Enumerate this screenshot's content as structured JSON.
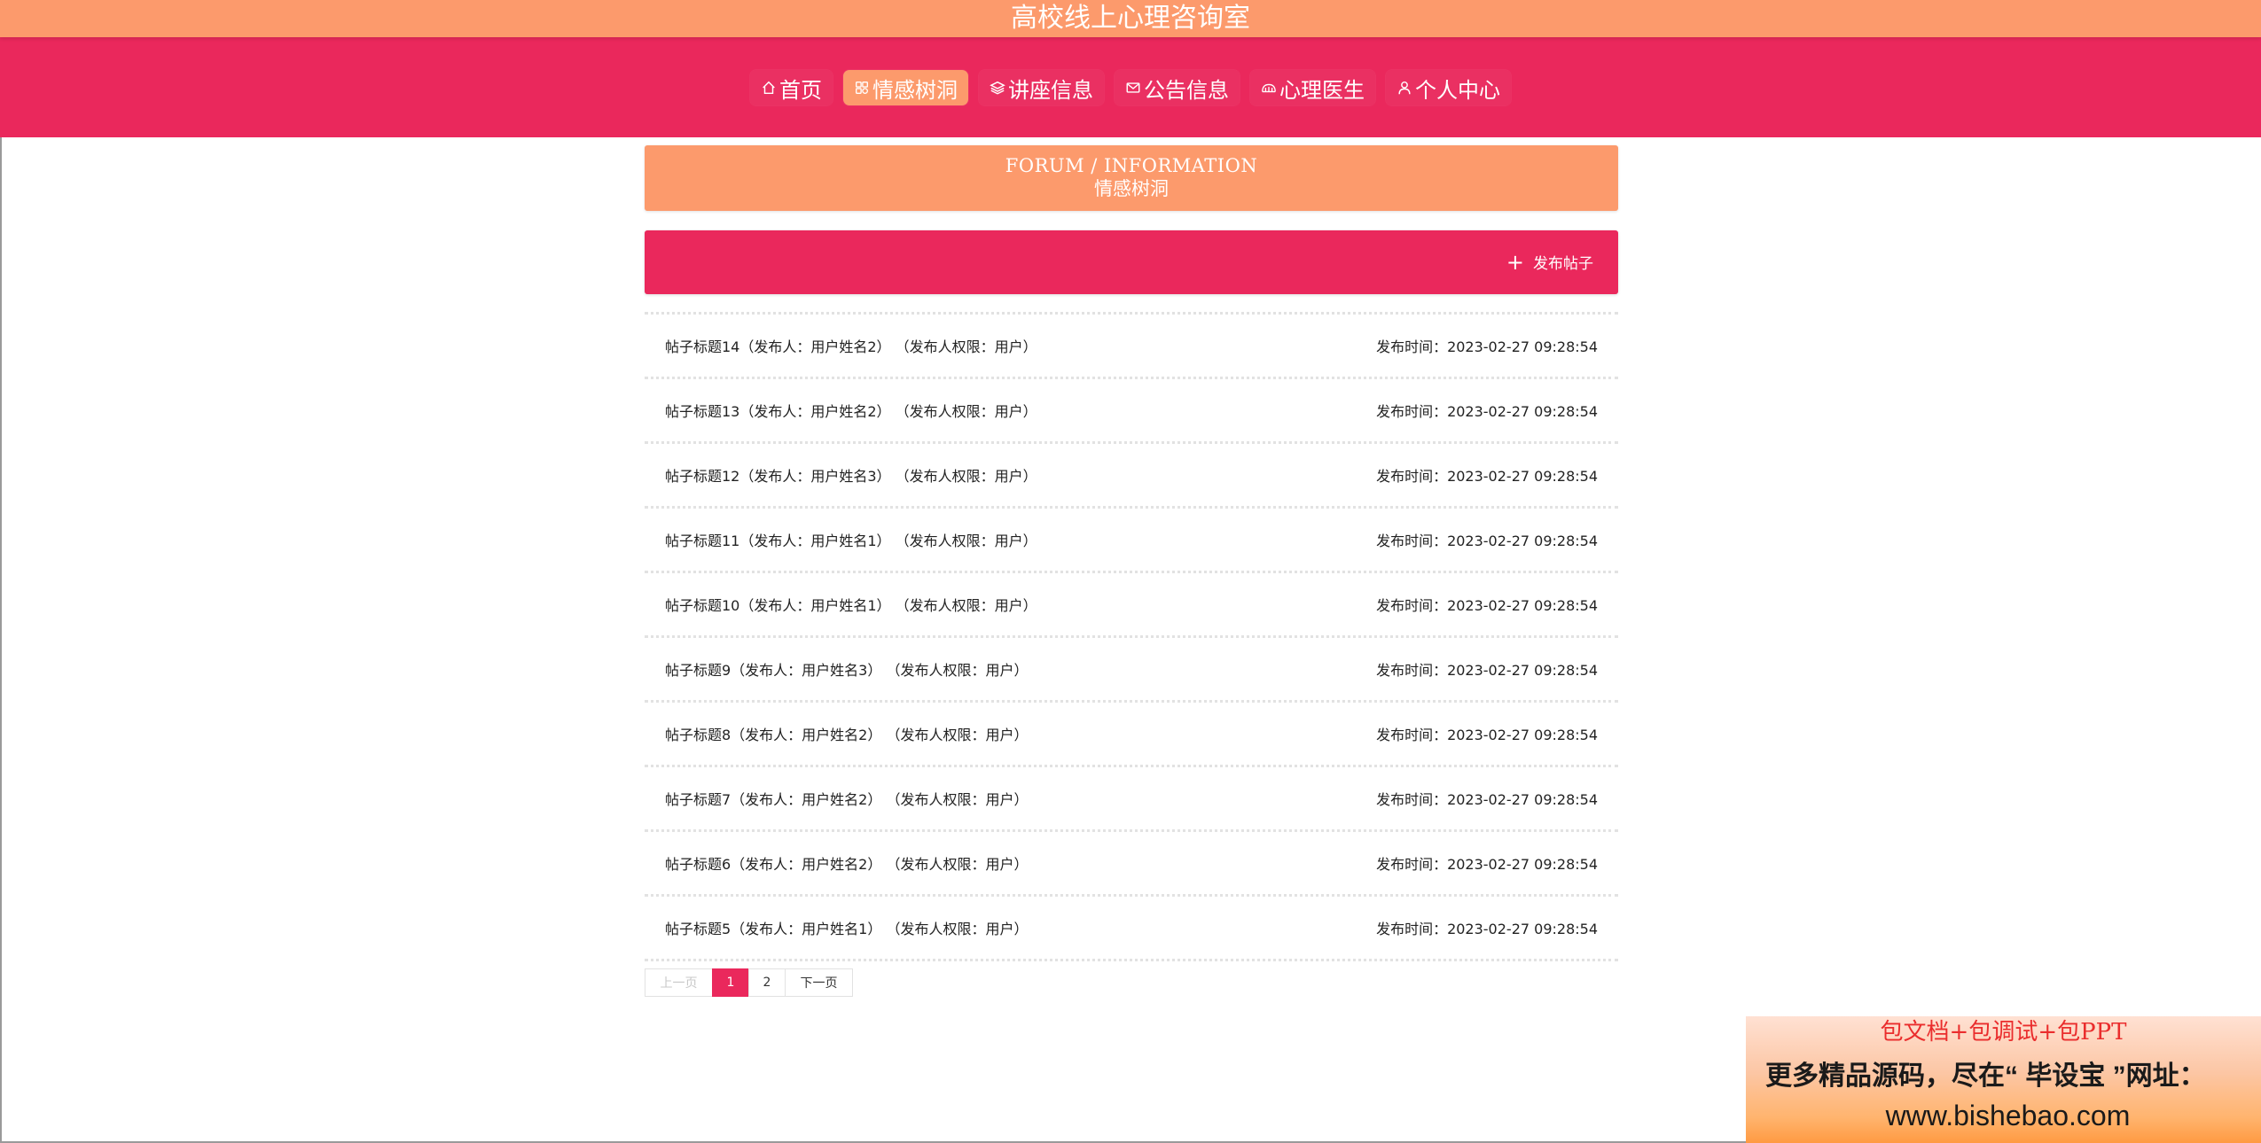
{
  "header": {
    "site_title": "高校线上心理咨询室"
  },
  "nav": {
    "items": [
      {
        "label": "首页",
        "icon": "home-icon",
        "active": false
      },
      {
        "label": "情感树洞",
        "icon": "tree-hole-icon",
        "active": true
      },
      {
        "label": "讲座信息",
        "icon": "layers-icon",
        "active": false
      },
      {
        "label": "公告信息",
        "icon": "mail-icon",
        "active": false
      },
      {
        "label": "心理医生",
        "icon": "doctor-icon",
        "active": false
      },
      {
        "label": "个人中心",
        "icon": "user-icon",
        "active": false
      }
    ]
  },
  "section": {
    "title_en": "FORUM / INFORMATION",
    "title_cn": "情感树洞"
  },
  "toolbar": {
    "publish_label": "发布帖子",
    "publish_icon": "plus-icon"
  },
  "posts": [
    {
      "title": "帖子标题14（发布人：用户姓名2） （发布人权限：用户）",
      "time": "发布时间：2023-02-27 09:28:54"
    },
    {
      "title": "帖子标题13（发布人：用户姓名2） （发布人权限：用户）",
      "time": "发布时间：2023-02-27 09:28:54"
    },
    {
      "title": "帖子标题12（发布人：用户姓名3） （发布人权限：用户）",
      "time": "发布时间：2023-02-27 09:28:54"
    },
    {
      "title": "帖子标题11（发布人：用户姓名1） （发布人权限：用户）",
      "time": "发布时间：2023-02-27 09:28:54"
    },
    {
      "title": "帖子标题10（发布人：用户姓名1） （发布人权限：用户）",
      "time": "发布时间：2023-02-27 09:28:54"
    },
    {
      "title": "帖子标题9（发布人：用户姓名3） （发布人权限：用户）",
      "time": "发布时间：2023-02-27 09:28:54"
    },
    {
      "title": "帖子标题8（发布人：用户姓名2） （发布人权限：用户）",
      "time": "发布时间：2023-02-27 09:28:54"
    },
    {
      "title": "帖子标题7（发布人：用户姓名2） （发布人权限：用户）",
      "time": "发布时间：2023-02-27 09:28:54"
    },
    {
      "title": "帖子标题6（发布人：用户姓名2） （发布人权限：用户）",
      "time": "发布时间：2023-02-27 09:28:54"
    },
    {
      "title": "帖子标题5（发布人：用户姓名1） （发布人权限：用户）",
      "time": "发布时间：2023-02-27 09:28:54"
    }
  ],
  "pagination": {
    "prev_label": "上一页",
    "pages": [
      "1",
      "2"
    ],
    "current": "1",
    "next_label": "下一页"
  },
  "ad": {
    "line1": "包文档+包调试+包PPT",
    "line2": "更多精品源码，尽在“ 毕设宝 ”网址：",
    "line3": "www.bishebao.com"
  },
  "colors": {
    "primary": "#ea285c",
    "accent": "#fc9a6c"
  }
}
